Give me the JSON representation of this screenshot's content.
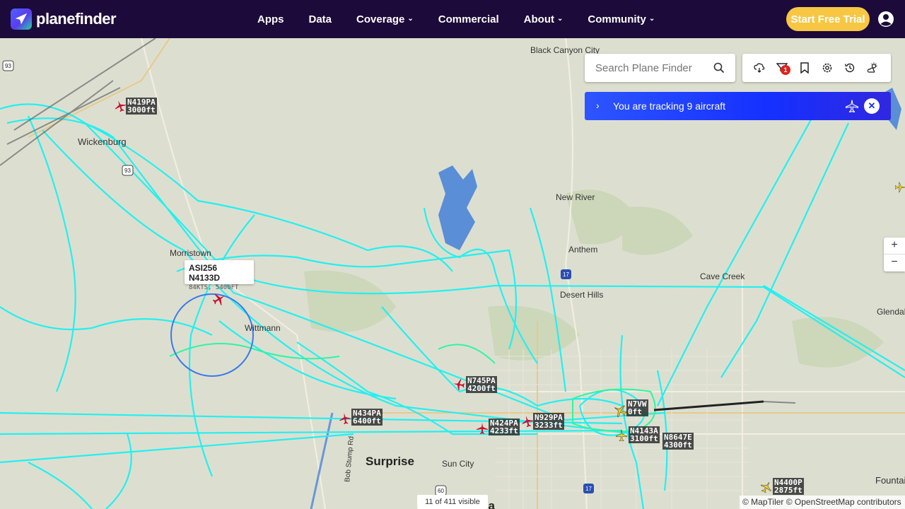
{
  "header": {
    "logo_text": "planefinder",
    "nav": [
      {
        "label": "Apps",
        "dropdown": false
      },
      {
        "label": "Data",
        "dropdown": false
      },
      {
        "label": "Coverage",
        "dropdown": true
      },
      {
        "label": "Commercial",
        "dropdown": false
      },
      {
        "label": "About",
        "dropdown": true
      },
      {
        "label": "Community",
        "dropdown": true
      }
    ],
    "trial_label": "Start Free Trial"
  },
  "search": {
    "placeholder": "Search Plane Finder"
  },
  "toolbar": {
    "icons": [
      "weather-icon",
      "filter-icon",
      "bookmark-icon",
      "settings-icon",
      "history-icon",
      "sun-cloud-icon"
    ],
    "filter_badge": "1"
  },
  "tracking": {
    "text": "You are tracking 9 aircraft"
  },
  "zoom": {
    "in": "+",
    "out": "−"
  },
  "places": [
    {
      "name": "Black Canyon City"
    },
    {
      "name": "Wickenburg"
    },
    {
      "name": "New River"
    },
    {
      "name": "Anthem"
    },
    {
      "name": "Cave Creek"
    },
    {
      "name": "Desert Hills"
    },
    {
      "name": "Morristown"
    },
    {
      "name": "Wittmann"
    },
    {
      "name": "Surprise"
    },
    {
      "name": "Sun City"
    },
    {
      "name": "Glendale"
    },
    {
      "name": "Fountain"
    },
    {
      "name": "Peoria"
    },
    {
      "name": "Bob Stump Rd"
    }
  ],
  "highway_shields": [
    "93",
    "93",
    "17",
    "17",
    "60"
  ],
  "aircraft": [
    {
      "callsign": "N419PA",
      "alt": "3000ft"
    },
    {
      "callsign": "N745PA",
      "alt": "4200ft"
    },
    {
      "callsign": "N434PA",
      "alt": "6400ft"
    },
    {
      "callsign": "N424PA",
      "alt": "4233ft"
    },
    {
      "callsign": "N929PA",
      "alt": "3233ft"
    },
    {
      "callsign": "N7VW",
      "alt": "0ft"
    },
    {
      "callsign": "N4143A",
      "alt": "3100ft"
    },
    {
      "callsign": "N8647E",
      "alt": "4300ft"
    },
    {
      "callsign": "N4400P",
      "alt": "2875ft"
    }
  ],
  "popup": {
    "title": "ASI256 N4133D",
    "detail": "84KTS, 5400FT"
  },
  "visible_count": "11 of 411 visible",
  "attribution": "© MapTiler © OpenStreetMap contributors",
  "colors": {
    "header_bg": "#1c0a3a",
    "trial": "#f7c744",
    "track": "#22f0f0",
    "track_green": "#2ef5a0",
    "banner": "#1530ff"
  }
}
